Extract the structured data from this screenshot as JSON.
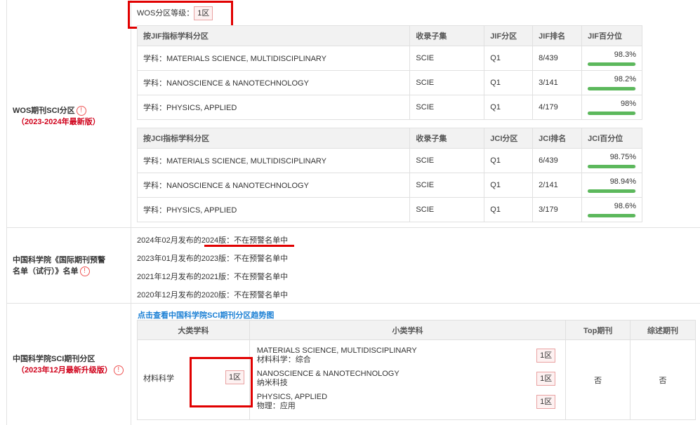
{
  "wos_label": "WOS期刊SCI分区",
  "wos_version": "（2023-2024年最新版）",
  "wos_grade_label": "WOS分区等级：",
  "wos_grade_value": "1区",
  "jif_headers": [
    "按JIF指标学科分区",
    "收录子集",
    "JIF分区",
    "JIF排名",
    "JIF百分位"
  ],
  "jif_rows": [
    {
      "subject": "学科：MATERIALS SCIENCE, MULTIDISCIPLINARY",
      "subset": "SCIE",
      "quartile": "Q1",
      "rank": "8/439",
      "pct": "98.3%",
      "pct_value": 98.3
    },
    {
      "subject": "学科：NANOSCIENCE & NANOTECHNOLOGY",
      "subset": "SCIE",
      "quartile": "Q1",
      "rank": "3/141",
      "pct": "98.2%",
      "pct_value": 98.2
    },
    {
      "subject": "学科：PHYSICS, APPLIED",
      "subset": "SCIE",
      "quartile": "Q1",
      "rank": "4/179",
      "pct": "98%",
      "pct_value": 98
    }
  ],
  "jci_headers": [
    "按JCI指标学科分区",
    "收录子集",
    "JCI分区",
    "JCI排名",
    "JCI百分位"
  ],
  "jci_rows": [
    {
      "subject": "学科：MATERIALS SCIENCE, MULTIDISCIPLINARY",
      "subset": "SCIE",
      "quartile": "Q1",
      "rank": "6/439",
      "pct": "98.75%",
      "pct_value": 98.75
    },
    {
      "subject": "学科：NANOSCIENCE & NANOTECHNOLOGY",
      "subset": "SCIE",
      "quartile": "Q1",
      "rank": "2/141",
      "pct": "98.94%",
      "pct_value": 98.94
    },
    {
      "subject": "学科：PHYSICS, APPLIED",
      "subset": "SCIE",
      "quartile": "Q1",
      "rank": "3/179",
      "pct": "98.6%",
      "pct_value": 98.6
    }
  ],
  "warning_label_1": "中国科学院《国际期刊预警",
  "warning_label_2": "名单（试行）》名单",
  "warnings": [
    "2024年02月发布的2024版：不在预警名单中",
    "2023年01月发布的2023版：不在预警名单中",
    "2021年12月发布的2021版：不在预警名单中",
    "2020年12月发布的2020版：不在预警名单中"
  ],
  "cas_label": "中国科学院SCI期刊分区",
  "cas_version": "（2023年12月最新升级版）",
  "cas_link": "点击查看中国科学院SCI期刊分区趋势图",
  "cas_headers": [
    "大类学科",
    "小类学科",
    "Top期刊",
    "综述期刊"
  ],
  "cas_major": "材料科学",
  "cas_major_zone": "1区",
  "cas_subs": [
    {
      "en": "MATERIALS SCIENCE, MULTIDISCIPLINARY",
      "cn": "材料科学：综合",
      "zone": "1区"
    },
    {
      "en": "NANOSCIENCE & NANOTECHNOLOGY",
      "cn": "纳米科技",
      "zone": "1区"
    },
    {
      "en": "PHYSICS, APPLIED",
      "cn": "物理：应用",
      "zone": "1区"
    }
  ],
  "cas_top": "否",
  "cas_review": "否",
  "info_icon": "!",
  "colors": {
    "accent_red": "#d0021b",
    "bar_green": "#5cb85c",
    "link_blue": "#1a7fd4",
    "highlight_red": "#e10000"
  }
}
